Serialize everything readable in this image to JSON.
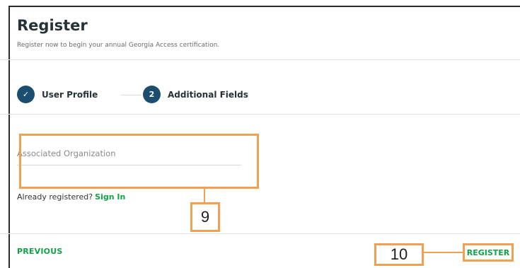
{
  "page": {
    "title": "Register",
    "subtitle": "Register now to begin your annual Georgia Access certification."
  },
  "stepper": {
    "steps": [
      {
        "label": "User Profile",
        "indicator": "✓",
        "state": "completed"
      },
      {
        "label": "Additional Fields",
        "indicator": "2",
        "state": "active"
      }
    ]
  },
  "form": {
    "associated_org_placeholder": "Associated Organization",
    "associated_org_value": ""
  },
  "signin": {
    "prompt": "Already registered?",
    "link": "Sign In"
  },
  "actions": {
    "previous_label": "PREVIOUS",
    "register_label": "REGISTER"
  },
  "callouts": {
    "field_number": "9",
    "register_number": "10"
  },
  "colors": {
    "primary": "#1b4e6e",
    "accent_green": "#12a24a",
    "callout_orange": "#f0a050"
  }
}
